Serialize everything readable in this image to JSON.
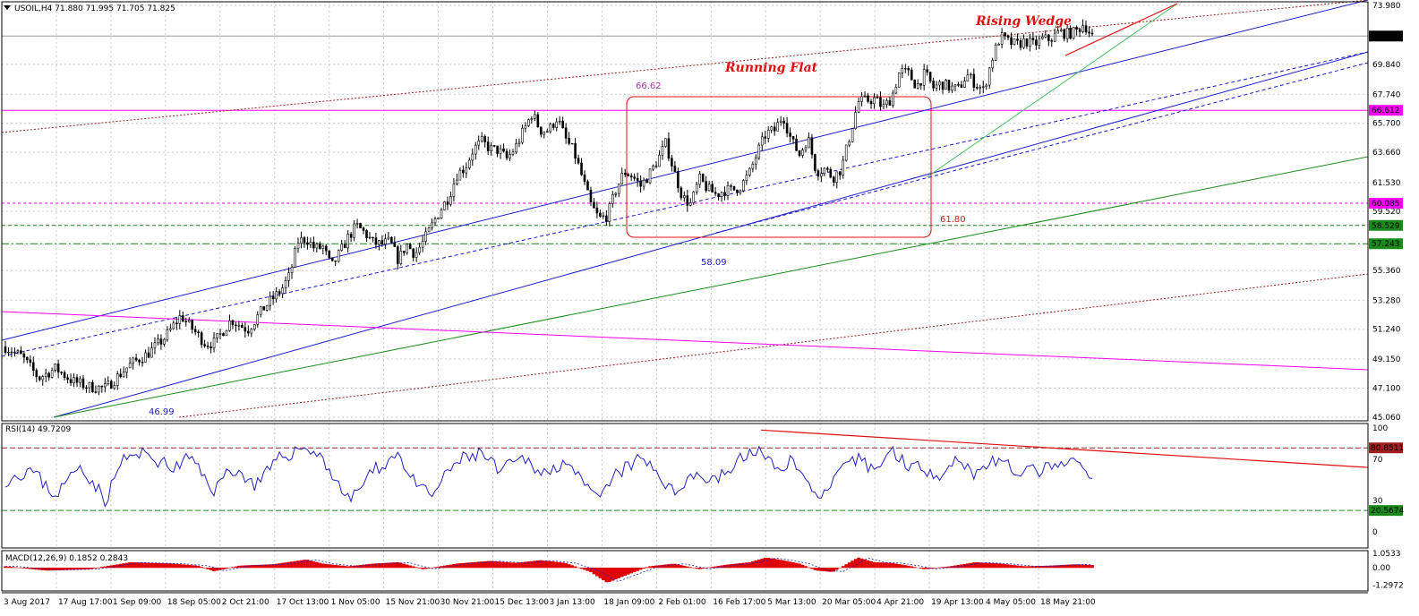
{
  "header": {
    "main": "USOIL,H4  71.880 71.995 71.705 71.825",
    "rsi": "RSI(14) 49.7209",
    "macd": "MACD(12,26,9) 0.1852 0.2843"
  },
  "colors": {
    "candle": "#000000",
    "grid": "#c8c8c8",
    "channel": "#1a1acc",
    "magenta": "#ff00ff",
    "green": "#1a8a1a",
    "lightgreen": "#40c060",
    "brown": "#a02020",
    "red": "#e01010",
    "rsi_line": "#2020c0",
    "macd_hist": "#e00000"
  },
  "chart_data": [
    {
      "type": "candlestick",
      "name": "price",
      "ylim": [
        45.06,
        73.98
      ],
      "y_ticks": [
        "73.980",
        "71.825",
        "69.840",
        "67.740",
        "65.700",
        "63.660",
        "61.530",
        "59.520",
        "58.529",
        "57.243",
        "55.360",
        "53.280",
        "51.240",
        "49.150",
        "47.100",
        "45.060"
      ],
      "current_price": "71.825",
      "x_ticks": [
        "3 Aug 2017",
        "17 Aug 17:00",
        "1 Sep 09:00",
        "18 Sep 05:00",
        "2 Oct 21:00",
        "17 Oct 13:00",
        "1 Nov 05:00",
        "15 Nov 21:00",
        "30 Nov 21:00",
        "15 Dec 13:00",
        "3 Jan 13:00",
        "18 Jan 09:00",
        "2 Feb 01:00",
        "16 Feb 17:00",
        "5 Mar 13:00",
        "20 Mar 05:00",
        "4 Apr 21:00",
        "19 Apr 13:00",
        "4 May 05:00",
        "18 May 21:00"
      ],
      "anchors": [
        [
          0,
          50.0
        ],
        [
          2,
          49.3
        ],
        [
          4,
          47.8
        ],
        [
          6,
          48.5
        ],
        [
          8,
          47.6
        ],
        [
          10,
          47.2
        ],
        [
          12,
          47.1
        ],
        [
          15,
          48.8
        ],
        [
          17,
          49.5
        ],
        [
          19,
          50.6
        ],
        [
          21,
          52.2
        ],
        [
          22,
          51.5
        ],
        [
          24,
          50.2
        ],
        [
          25,
          50.3
        ],
        [
          27,
          51.9
        ],
        [
          29,
          51.2
        ],
        [
          31,
          52.8
        ],
        [
          33,
          54.0
        ],
        [
          34,
          55.0
        ],
        [
          35,
          57.4
        ],
        [
          36,
          57.6
        ],
        [
          37,
          56.9
        ],
        [
          38,
          57.0
        ],
        [
          39,
          55.6
        ],
        [
          40,
          56.6
        ],
        [
          41,
          57.7
        ],
        [
          42,
          58.5
        ],
        [
          43,
          58.0
        ],
        [
          44,
          57.3
        ],
        [
          45,
          57.2
        ],
        [
          46,
          57.4
        ],
        [
          47,
          56.1
        ],
        [
          48,
          57.2
        ],
        [
          49,
          56.5
        ],
        [
          50,
          57.4
        ],
        [
          51,
          58.5
        ],
        [
          52,
          59.6
        ],
        [
          53,
          60.5
        ],
        [
          54,
          62.1
        ],
        [
          55,
          62.6
        ],
        [
          56,
          63.9
        ],
        [
          57,
          64.4
        ],
        [
          58,
          63.9
        ],
        [
          59,
          63.8
        ],
        [
          60,
          63.2
        ],
        [
          61,
          64.0
        ],
        [
          62,
          65.2
        ],
        [
          63,
          66.4
        ],
        [
          64,
          65.2
        ],
        [
          65,
          65.2
        ],
        [
          66,
          66.1
        ],
        [
          67,
          64.6
        ],
        [
          68,
          63.7
        ],
        [
          69,
          61.9
        ],
        [
          70,
          60.0
        ],
        [
          71,
          59.0
        ],
        [
          72,
          59.2
        ],
        [
          73,
          61.0
        ],
        [
          74,
          62.3
        ],
        [
          75,
          62.0
        ],
        [
          76,
          61.3
        ],
        [
          77,
          62.1
        ],
        [
          78,
          63.1
        ],
        [
          79,
          64.3
        ],
        [
          80,
          62.3
        ],
        [
          81,
          60.5
        ],
        [
          82,
          60.0
        ],
        [
          83,
          61.8
        ],
        [
          84,
          61.1
        ],
        [
          85,
          60.7
        ],
        [
          86,
          61.0
        ],
        [
          87,
          61.0
        ],
        [
          88,
          61.3
        ],
        [
          89,
          62.2
        ],
        [
          90,
          63.7
        ],
        [
          91,
          65.0
        ],
        [
          92,
          65.2
        ],
        [
          93,
          66.3
        ],
        [
          94,
          64.5
        ],
        [
          95,
          63.5
        ],
        [
          96,
          64.7
        ],
        [
          97,
          62.3
        ],
        [
          98,
          62.5
        ],
        [
          99,
          61.9
        ],
        [
          100,
          62.5
        ],
        [
          101,
          64.8
        ],
        [
          102,
          67.2
        ],
        [
          103,
          67.3
        ],
        [
          104,
          67.4
        ],
        [
          105,
          66.8
        ],
        [
          106,
          67.5
        ],
        [
          107,
          69.4
        ],
        [
          108,
          69.2
        ],
        [
          109,
          68.3
        ],
        [
          110,
          69.2
        ],
        [
          111,
          68.2
        ],
        [
          112,
          68.5
        ],
        [
          113,
          68.2
        ],
        [
          114,
          68.1
        ],
        [
          115,
          69.1
        ],
        [
          116,
          68.5
        ],
        [
          117,
          68.0
        ],
        [
          118,
          70.2
        ],
        [
          119,
          71.8
        ],
        [
          120,
          71.4
        ],
        [
          121,
          71.2
        ],
        [
          122,
          71.5
        ],
        [
          123,
          71.2
        ],
        [
          124,
          71.6
        ],
        [
          125,
          71.6
        ],
        [
          126,
          72.1
        ],
        [
          127,
          72.0
        ],
        [
          128,
          72.1
        ],
        [
          129,
          72.7
        ],
        [
          130,
          71.8
        ]
      ],
      "hlines": [
        "66.612",
        "60.085",
        "58.529",
        "57.243"
      ],
      "labels": [
        "66.62",
        "58.09",
        "61.80",
        "46.99"
      ],
      "annotations": [
        "Running Flat",
        "Rising Wedge"
      ]
    },
    {
      "type": "line",
      "name": "RSI(14)",
      "ylim": [
        0,
        100
      ],
      "y_ticks": [
        "100",
        "80.8511",
        "70",
        "30",
        "20.5674",
        "0"
      ],
      "levels": [
        "80.8511",
        "20.5674"
      ],
      "anchors": [
        [
          0,
          50
        ],
        [
          3,
          60
        ],
        [
          6,
          35
        ],
        [
          9,
          65
        ],
        [
          12,
          30
        ],
        [
          14,
          70
        ],
        [
          17,
          75
        ],
        [
          20,
          60
        ],
        [
          22,
          72
        ],
        [
          25,
          40
        ],
        [
          27,
          62
        ],
        [
          30,
          45
        ],
        [
          33,
          72
        ],
        [
          36,
          82
        ],
        [
          38,
          70
        ],
        [
          41,
          30
        ],
        [
          44,
          58
        ],
        [
          47,
          76
        ],
        [
          49,
          45
        ],
        [
          51,
          35
        ],
        [
          54,
          68
        ],
        [
          57,
          76
        ],
        [
          59,
          58
        ],
        [
          62,
          70
        ],
        [
          65,
          55
        ],
        [
          67,
          72
        ],
        [
          69,
          45
        ],
        [
          71,
          30
        ],
        [
          73,
          55
        ],
        [
          76,
          70
        ],
        [
          78,
          58
        ],
        [
          80,
          35
        ],
        [
          82,
          58
        ],
        [
          84,
          50
        ],
        [
          86,
          55
        ],
        [
          88,
          70
        ],
        [
          90,
          80
        ],
        [
          92,
          60
        ],
        [
          94,
          70
        ],
        [
          96,
          45
        ],
        [
          98,
          35
        ],
        [
          100,
          58
        ],
        [
          102,
          70
        ],
        [
          104,
          60
        ],
        [
          106,
          78
        ],
        [
          108,
          65
        ],
        [
          110,
          60
        ],
        [
          112,
          56
        ],
        [
          114,
          72
        ],
        [
          116,
          55
        ],
        [
          118,
          70
        ],
        [
          120,
          62
        ],
        [
          122,
          57
        ],
        [
          124,
          60
        ],
        [
          126,
          62
        ],
        [
          128,
          68
        ],
        [
          130,
          50
        ]
      ]
    },
    {
      "type": "bar",
      "name": "MACD(12,26,9)",
      "ylim": [
        -1.2972,
        1.0533
      ],
      "y_ticks": [
        "1.0533",
        "0.00",
        "-1.2972"
      ],
      "anchors": [
        [
          0,
          0.1
        ],
        [
          5,
          -0.2
        ],
        [
          10,
          -0.1
        ],
        [
          15,
          0.4
        ],
        [
          20,
          0.3
        ],
        [
          23,
          0.15
        ],
        [
          25,
          -0.25
        ],
        [
          28,
          0.15
        ],
        [
          32,
          0.25
        ],
        [
          36,
          0.6
        ],
        [
          38,
          0.3
        ],
        [
          41,
          0.1
        ],
        [
          44,
          0.3
        ],
        [
          47,
          0.4
        ],
        [
          50,
          -0.1
        ],
        [
          54,
          0.3
        ],
        [
          58,
          0.5
        ],
        [
          61,
          0.35
        ],
        [
          64,
          0.55
        ],
        [
          67,
          0.35
        ],
        [
          70,
          -0.3
        ],
        [
          72,
          -1.1
        ],
        [
          74,
          -0.6
        ],
        [
          77,
          0.1
        ],
        [
          80,
          0.3
        ],
        [
          83,
          -0.1
        ],
        [
          86,
          0.2
        ],
        [
          89,
          0.4
        ],
        [
          91,
          0.75
        ],
        [
          93,
          0.55
        ],
        [
          95,
          0.3
        ],
        [
          97,
          -0.2
        ],
        [
          99,
          -0.3
        ],
        [
          102,
          0.75
        ],
        [
          104,
          0.4
        ],
        [
          106,
          0.35
        ],
        [
          108,
          0.15
        ],
        [
          110,
          -0.1
        ],
        [
          113,
          0.1
        ],
        [
          116,
          0.4
        ],
        [
          119,
          0.3
        ],
        [
          122,
          0.1
        ],
        [
          125,
          0.15
        ],
        [
          128,
          0.25
        ],
        [
          130,
          0.2
        ]
      ]
    }
  ]
}
